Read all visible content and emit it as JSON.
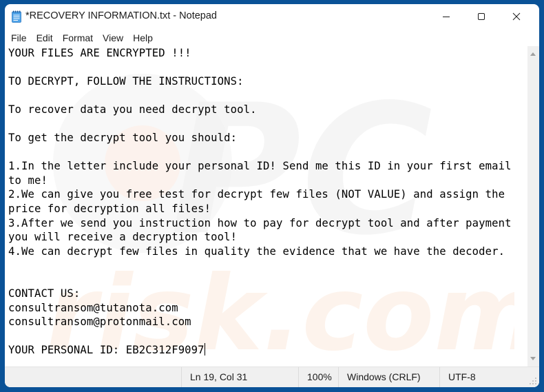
{
  "window": {
    "title": "*RECOVERY INFORMATION.txt - Notepad",
    "app_icon": "notepad-icon",
    "controls": {
      "minimize": "minimize-icon",
      "maximize": "maximize-icon",
      "close": "close-icon"
    }
  },
  "menu": {
    "items": [
      {
        "label": "File"
      },
      {
        "label": "Edit"
      },
      {
        "label": "Format"
      },
      {
        "label": "View"
      },
      {
        "label": "Help"
      }
    ]
  },
  "editor": {
    "lines": [
      "YOUR FILES ARE ENCRYPTED !!!",
      "",
      "TO DECRYPT, FOLLOW THE INSTRUCTIONS:",
      "",
      "To recover data you need decrypt tool.",
      "",
      "To get the decrypt tool you should:",
      "",
      "1.In the letter include your personal ID! Send me this ID in your first email",
      "to me!",
      "2.We can give you free test for decrypt few files (NOT VALUE) and assign the",
      "price for decryption all files!",
      "3.After we send you instruction how to pay for decrypt tool and after payment",
      "you will receive a decryption tool!",
      "4.We can decrypt few files in quality the evidence that we have the decoder.",
      "",
      "",
      "CONTACT US:",
      "consultransom@tutanota.com",
      "consultransom@protonmail.com",
      "",
      "YOUR PERSONAL ID: EB2C312F9097"
    ],
    "watermark": {
      "top_text": "PC",
      "bottom_text": "risk.com"
    }
  },
  "statusbar": {
    "position": "Ln 19, Col 31",
    "zoom": "100%",
    "line_ending": "Windows (CRLF)",
    "encoding": "UTF-8"
  },
  "colors": {
    "desktop_background": "#0a5297",
    "window_background": "#ffffff",
    "statusbar_background": "#f0f0f0",
    "icon_accent": "#2b88d8"
  }
}
